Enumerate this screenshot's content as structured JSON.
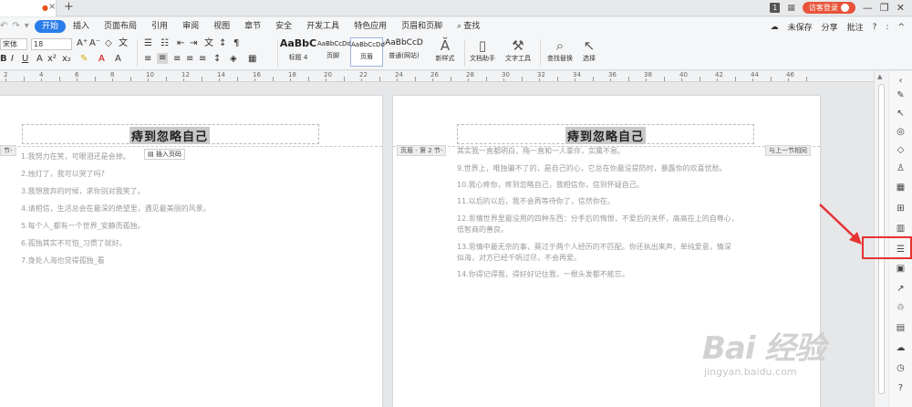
{
  "titlebar": {
    "new_tab": "+",
    "page_badge": "1",
    "login_label": "访客登录",
    "controls": [
      "—",
      "❐",
      "✕"
    ]
  },
  "menubar": {
    "tabs": [
      "开始",
      "插入",
      "页面布局",
      "引用",
      "审阅",
      "视图",
      "章节",
      "安全",
      "开发工具",
      "特色应用",
      "页眉和页脚"
    ],
    "search_label": "查找",
    "right": [
      "未保存",
      "分享",
      "批注",
      "?",
      ":",
      "^"
    ]
  },
  "ribbon": {
    "font_name": "宋体",
    "font_size": "18",
    "styles": [
      {
        "sample": "AaBbC",
        "label": "标题 4"
      },
      {
        "sample": "AaBbCcDd",
        "label": "页脚"
      },
      {
        "sample": "AaBbCcDd",
        "label": "页眉"
      },
      {
        "sample": "AaBbCcD",
        "label": "普通(网站)"
      }
    ],
    "new_style": "新样式",
    "doc_helper": "文档助手",
    "text_tools": "文字工具",
    "find_replace": "查找替换",
    "select": "选择"
  },
  "ruler": {
    "numbers": [
      "2",
      "4",
      "6",
      "8",
      "10",
      "12",
      "14",
      "16",
      "18",
      "20",
      "22",
      "24",
      "26",
      "28",
      "30",
      "32",
      "34",
      "36",
      "38",
      "40",
      "42",
      "44",
      "46"
    ]
  },
  "left_page": {
    "header_title": "痔到忽略自己",
    "section_tag": "节-",
    "insert_page_number": "插入页码",
    "lines": [
      "1.我努力在笑，可眼泪还是会掉。",
      "2.烛灯了，我可以哭了吗？",
      "3.我想放弃的时候，求你别对我笑了。",
      "4.请相信，生活总会在最深的绝望里，遇见最美丽的风景。",
      "5.每个人_都有一个世界_安静而孤独。",
      "6.孤独其实不可怕_习惯了就好。",
      "7.身处人海也觉得孤独_看"
    ]
  },
  "right_page": {
    "header_title": "痔到忽略自己",
    "section_tag": "页眉 - 第 2 节-",
    "same_as_previous": "与上一节相同",
    "lines": [
      "其实我一直都明白，殇一直和一人拿伴，实属不易。",
      "9.世界上，唯独骗不了的，是自己的心，它总在你最没提防时，暴露你的欢喜忧愁。",
      "10.我心疼你，疼到忽略自己，我相信你，信到怀疑自己。",
      "11.以后的以后，我不会再等待你了，信然你在。",
      "12.思情世界里最没用的四种东西：分手后的悔恨，不爱后的关怀，高高在上的自尊心，",
      "低智商的善良。",
      "13.思情中最无奈的事，莫过于两个人经历的不匹配。你还执出来声，单纯爱意，情深",
      "似海，对方已经千帆过尽，不会再爱。",
      "14.你得记得我，得好好记住我，一根头发都不能忘。"
    ]
  },
  "watermark": {
    "main": "Bai 经验",
    "sub": "jingyan.baidu.com"
  },
  "colors": {
    "accent": "#2b7de9",
    "highlight": "#e63232",
    "login": "#e8543a"
  }
}
